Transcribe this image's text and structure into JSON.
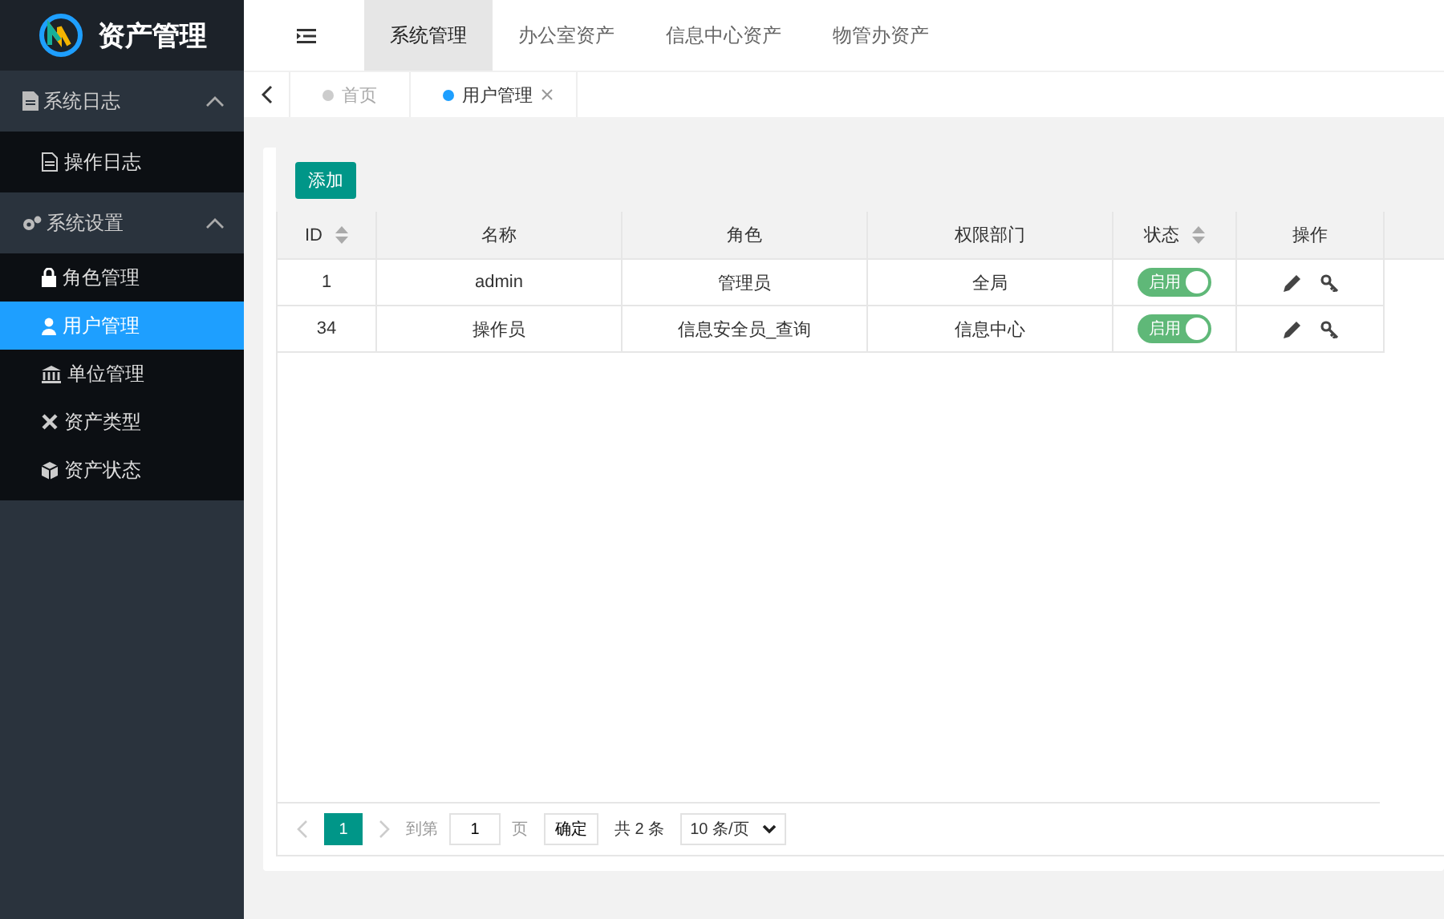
{
  "app": {
    "title": "资产管理"
  },
  "top_nav": [
    {
      "label": "系统管理",
      "selected": true
    },
    {
      "label": "办公室资产",
      "selected": false
    },
    {
      "label": "信息中心资产",
      "selected": false
    },
    {
      "label": "物管办资产",
      "selected": false
    }
  ],
  "page_tabs": [
    {
      "label": "首页",
      "selected": false,
      "closable": false
    },
    {
      "label": "用户管理",
      "selected": true,
      "closable": true
    }
  ],
  "sidebar": {
    "items": [
      {
        "label": "系统日志",
        "kind": "log",
        "expanded": true,
        "children": [
          {
            "label": "操作日志",
            "kind": "doc",
            "selected": false
          }
        ]
      },
      {
        "label": "系统设置",
        "kind": "gears",
        "expanded": true,
        "children": [
          {
            "label": "角色管理",
            "kind": "lock",
            "selected": false
          },
          {
            "label": "用户管理",
            "kind": "user",
            "selected": true
          },
          {
            "label": "单位管理",
            "kind": "bank",
            "selected": false
          },
          {
            "label": "资产类型",
            "kind": "cross",
            "selected": false
          },
          {
            "label": "资产状态",
            "kind": "cube",
            "selected": false
          }
        ]
      }
    ]
  },
  "toolbar": {
    "add_button": "添加"
  },
  "table": {
    "columns": [
      {
        "label": "ID",
        "sortable": true
      },
      {
        "label": "名称",
        "sortable": false
      },
      {
        "label": "角色",
        "sortable": false
      },
      {
        "label": "权限部门",
        "sortable": false
      },
      {
        "label": "状态",
        "sortable": true
      },
      {
        "label": "操作",
        "sortable": false
      }
    ],
    "rows": [
      {
        "id": "1",
        "name": "admin",
        "role": "管理员",
        "dept": "全局",
        "status": {
          "label": "启用",
          "on": true
        }
      },
      {
        "id": "34",
        "name": "操作员",
        "role": "信息安全员_查询",
        "dept": "信息中心",
        "status": {
          "label": "启用",
          "on": true
        }
      }
    ]
  },
  "pager": {
    "pages": [
      {
        "label": "1",
        "selected": true
      }
    ],
    "goto_label": "到第",
    "goto_value": "1",
    "page_unit": "页",
    "confirm": "确定",
    "total": "共 2 条",
    "page_size": "10 条/页"
  }
}
